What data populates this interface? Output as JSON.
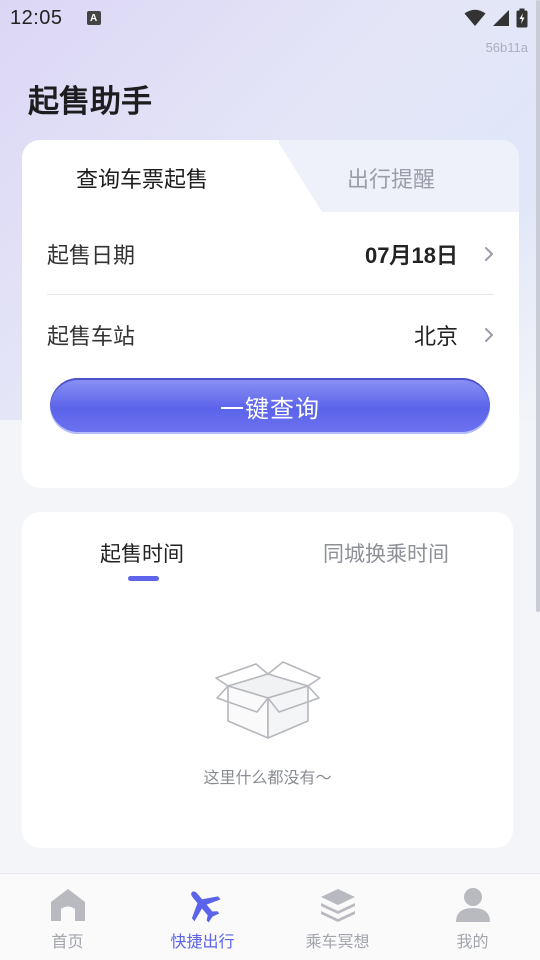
{
  "status_bar": {
    "time": "12:05",
    "notification_icon": "a-icon",
    "wifi_icon": "wifi-icon",
    "signal_icon": "signal-icon",
    "battery_icon": "battery-icon"
  },
  "build_tag": "56b11a",
  "app_title": "起售助手",
  "query_card": {
    "tabs": [
      {
        "label": "查询车票起售",
        "active": true
      },
      {
        "label": "出行提醒",
        "active": false
      }
    ],
    "rows": [
      {
        "label": "起售日期",
        "value": "07月18日"
      },
      {
        "label": "起售车站",
        "value": "北京"
      }
    ],
    "button_label": "一键查询"
  },
  "result_card": {
    "tabs": [
      {
        "label": "起售时间",
        "active": true
      },
      {
        "label": "同城换乘时间",
        "active": false
      }
    ],
    "empty_text": "这里什么都没有～"
  },
  "bottom_nav": {
    "items": [
      {
        "label": "首页",
        "icon": "home-icon",
        "active": false
      },
      {
        "label": "快捷出行",
        "icon": "airplane-icon",
        "active": true
      },
      {
        "label": "乘车冥想",
        "icon": "layers-icon",
        "active": false
      },
      {
        "label": "我的",
        "icon": "user-icon",
        "active": false
      }
    ]
  },
  "colors": {
    "accent": "#5b63ea",
    "inactive": "#a2a5ad"
  }
}
